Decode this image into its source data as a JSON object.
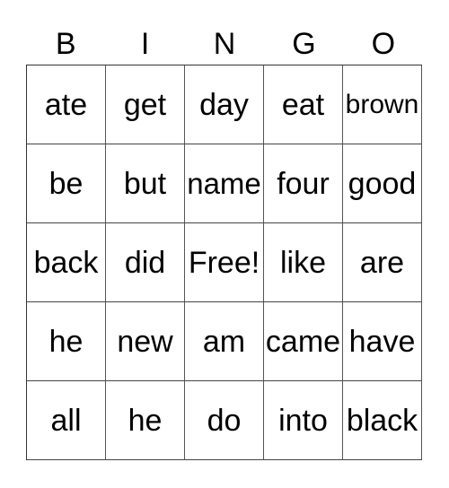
{
  "header": [
    "B",
    "I",
    "N",
    "G",
    "O"
  ],
  "cells": [
    [
      "ate",
      "get",
      "day",
      "eat",
      "brown"
    ],
    [
      "be",
      "but",
      "name",
      "four",
      "good"
    ],
    [
      "back",
      "did",
      "Free!",
      "like",
      "are"
    ],
    [
      "he",
      "new",
      "am",
      "came",
      "have"
    ],
    [
      "all",
      "he",
      "do",
      "into",
      "black"
    ]
  ]
}
